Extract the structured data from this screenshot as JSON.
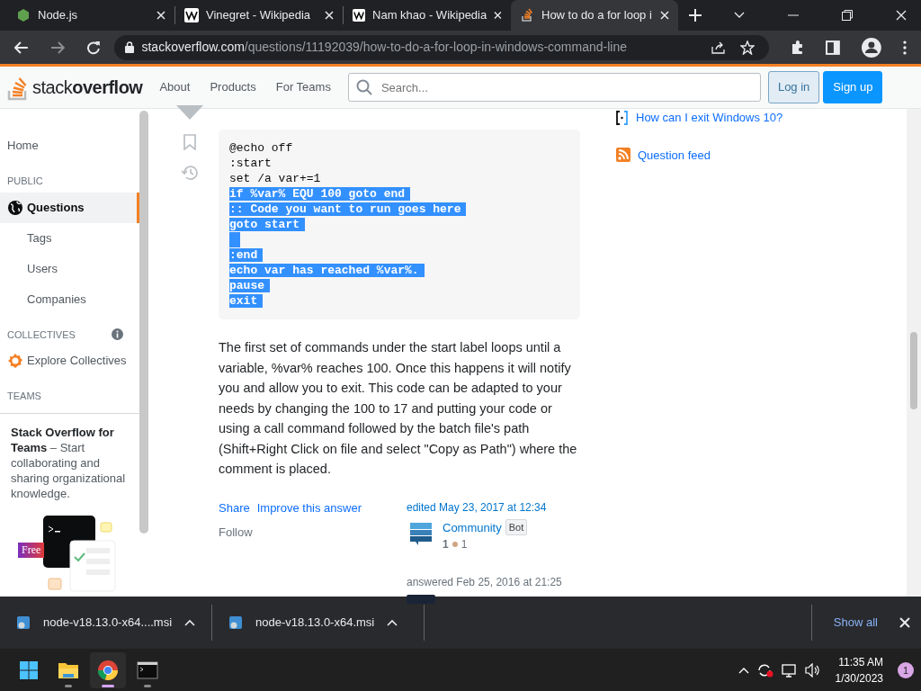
{
  "browser": {
    "tabs": [
      {
        "title": "Node.js",
        "kind": "node",
        "selected": false
      },
      {
        "title": "Vinegret - Wikipedia",
        "kind": "wiki",
        "selected": false
      },
      {
        "title": "Nam khao - Wikipedia",
        "kind": "wiki",
        "selected": false
      },
      {
        "title": "How to do a for loop i",
        "kind": "so",
        "selected": true
      }
    ],
    "url_host": "stackoverflow.com",
    "url_path": "/questions/11192039/how-to-do-a-for-loop-in-windows-command-line"
  },
  "header": {
    "logo": "stack**overflow**",
    "nav": [
      "About",
      "Products",
      "For Teams"
    ],
    "search": {
      "placeholder": "Search..."
    },
    "login": "Log in",
    "signup": "Sign up"
  },
  "sidebar": {
    "items": [
      {
        "kind": "link",
        "label": "Home",
        "selected": false
      },
      {
        "kind": "heading",
        "label": "PUBLIC"
      },
      {
        "kind": "globe",
        "label": "Questions",
        "selected": true
      },
      {
        "kind": "sublink",
        "label": "Tags",
        "selected": false
      },
      {
        "kind": "sublink",
        "label": "Users",
        "selected": false
      },
      {
        "kind": "sublink",
        "label": "Companies",
        "selected": false
      },
      {
        "kind": "heading_info",
        "label": "COLLECTIVES"
      },
      {
        "kind": "collective",
        "label": "Explore Collectives",
        "selected": false
      },
      {
        "kind": "heading",
        "label": "TEAMS"
      }
    ],
    "teams": {
      "text": "**Stack Overflow for Teams** – Start collaborating and sharing organizational knowledge.",
      "badge": "Free"
    }
  },
  "answer": {
    "code_lines": [
      {
        "text": "@echo off",
        "selected": false
      },
      {
        "text": ":start",
        "selected": false
      },
      {
        "text": "set /a var+=1",
        "selected": false
      },
      {
        "text": "if %var% EQU 100 goto end",
        "selected": true
      },
      {
        "text": ":: Code you want to run goes here",
        "selected": true
      },
      {
        "text": "goto start",
        "selected": true
      },
      {
        "selected": true
      },
      {
        "text": ":end",
        "selected": true
      },
      {
        "text": "echo var has reached %var%.",
        "selected": true
      },
      {
        "text": "pause",
        "selected": true
      },
      {
        "text": "exit",
        "selected": true
      }
    ],
    "paragraph": "The first set of commands under the start label loops until a variable, %var% reaches 100. Once this happens it will notify you and allow you to exit. This code can be adapted to your needs by changing the 100 to 17 and putting your code or using a call command followed by the batch file's path (Shift+Right Click on file and select \"Copy as Path\") where the comment is placed.",
    "menu": [
      "Share",
      "Improve this answer",
      "Follow"
    ],
    "edited": "edited May 23, 2017 at 12:34",
    "editor": {
      "name": "Community",
      "badge": "Bot",
      "reputation": "1",
      "bronze": "1"
    },
    "answered": "answered Feb 25, 2016 at 21:25"
  },
  "right_links": [
    {
      "kind": "meta",
      "label": "How can I exit Windows 10?"
    },
    {
      "kind": "feed",
      "label": "Question feed"
    }
  ],
  "downloads": {
    "items": [
      "node-v18.13.0-x64....msi",
      "node-v18.13.0-x64.msi"
    ],
    "show_all": "Show all"
  },
  "taskbar": {
    "apps": [
      {
        "kind": "windows",
        "selected": false
      },
      {
        "kind": "explorer",
        "selected": false
      },
      {
        "kind": "chrome",
        "selected": true
      },
      {
        "kind": "terminal",
        "selected": false
      }
    ],
    "time": "11:35 AM",
    "date": "1/30/2023",
    "notifications": "1"
  }
}
